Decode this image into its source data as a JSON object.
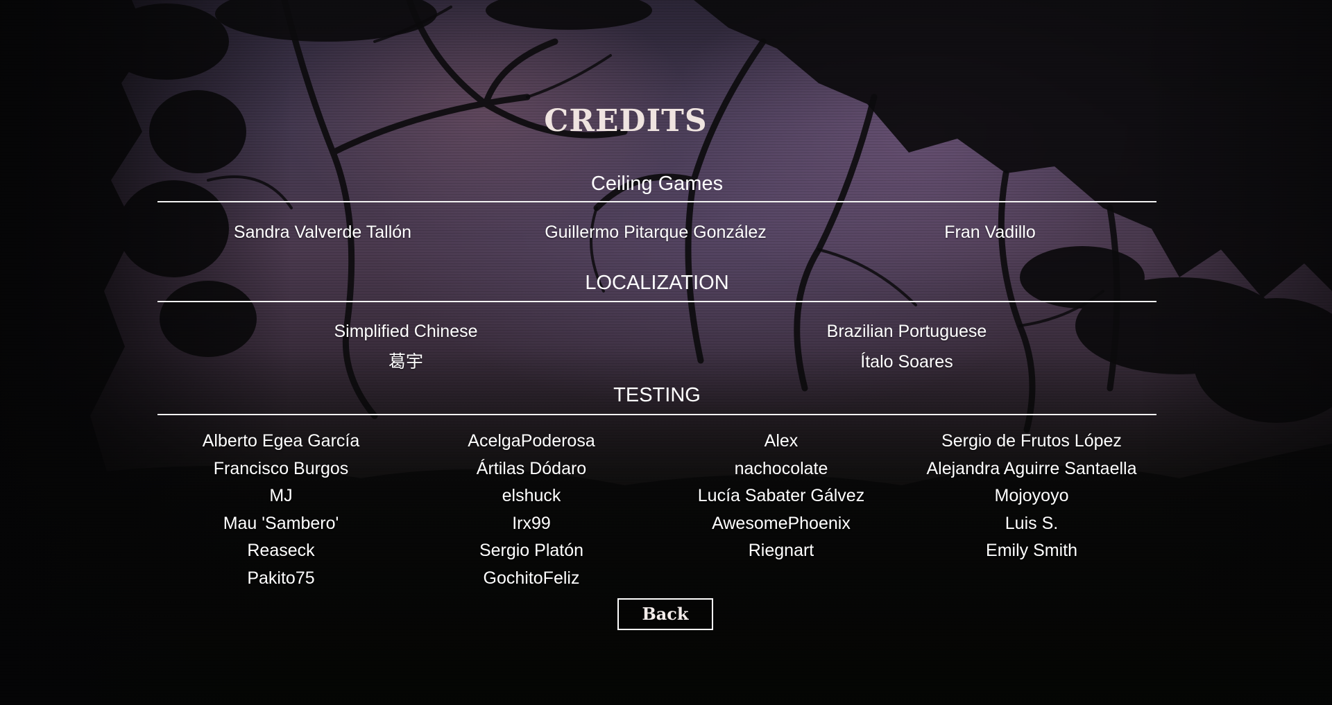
{
  "title": "CREDITS",
  "team": {
    "heading": "Ceiling Games",
    "members": [
      "Sandra Valverde Tallón",
      "Guillermo Pitarque González",
      "Fran Vadillo"
    ]
  },
  "localization": {
    "heading": "LOCALIZATION",
    "languages": [
      {
        "language": "Simplified Chinese",
        "translator": "葛宇"
      },
      {
        "language": "Brazilian Portuguese",
        "translator": "Ítalo Soares"
      }
    ]
  },
  "testing": {
    "heading": "TESTING",
    "columns": [
      [
        "Alberto Egea García",
        "Francisco Burgos",
        "MJ",
        "Mau 'Sambero'",
        "Reaseck",
        "Pakito75"
      ],
      [
        "AcelgaPoderosa",
        "Ártilas Dódaro",
        "elshuck",
        "Irx99",
        "Sergio Platón",
        "GochitoFeliz"
      ],
      [
        "Alex",
        "nachocolate",
        "Lucía Sabater Gálvez",
        "AwesomePhoenix",
        "Riegnart"
      ],
      [
        "Sergio de Frutos López",
        "Alejandra Aguirre Santaella",
        "Mojoyoyo",
        "Luis S.",
        "Emily Smith"
      ]
    ]
  },
  "back_label": "Back"
}
